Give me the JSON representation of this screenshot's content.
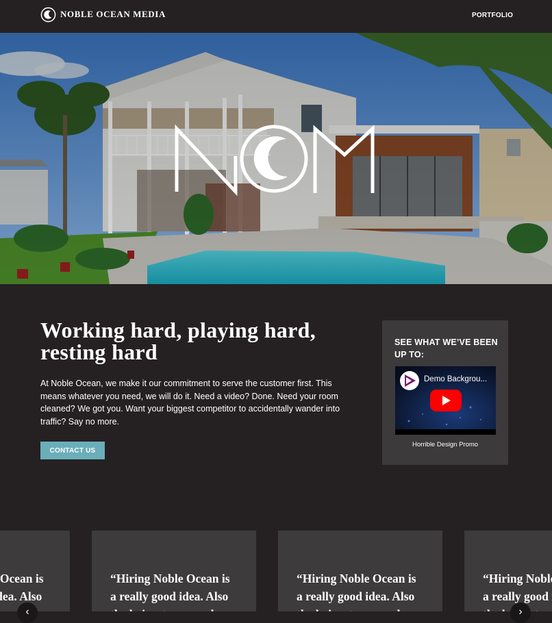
{
  "header": {
    "brand_name": "NOBLE OCEAN MEDIA",
    "nav_portfolio": "PORTFOLIO"
  },
  "hero": {
    "logo_icon": "nom-logo-icon"
  },
  "main": {
    "headline": "Working hard, playing hard, resting hard",
    "intro": "At Noble Ocean, we make it our commitment to serve the customer first. This means whatever you need, we will do it. Need a video? Done. Need your room cleaned? We got you. Want your biggest competitor to accidentally wander into traffic? Say no more.",
    "contact_button": "CONTACT US"
  },
  "video_widget": {
    "heading": "SEE WHAT WE’VE BEEN UP TO:",
    "video_title": "Demo Backgrou...",
    "caption": "Horrible Design Promo"
  },
  "testimonials": {
    "cards": [
      {
        "quote": "“Hiring Noble Ocean is\na really good idea. Also\nthe haircuts are cool"
      },
      {
        "quote": "“Hiring Noble Ocean is\na really good idea. Also\nthe haircuts are cool"
      },
      {
        "quote": "“Hiring Noble Ocean is\na really good idea. Also\nthe haircuts are cool"
      },
      {
        "quote": "“Hiring Noble Ocean is\na really good idea. Also\nthe haircuts are cool"
      }
    ],
    "prev_icon": "chevron-left-icon",
    "next_icon": "chevron-right-icon"
  },
  "colors": {
    "background": "#252122",
    "card": "#3d3b3c",
    "accent": "#6aaeb9",
    "youtube_red": "#ff0000"
  }
}
